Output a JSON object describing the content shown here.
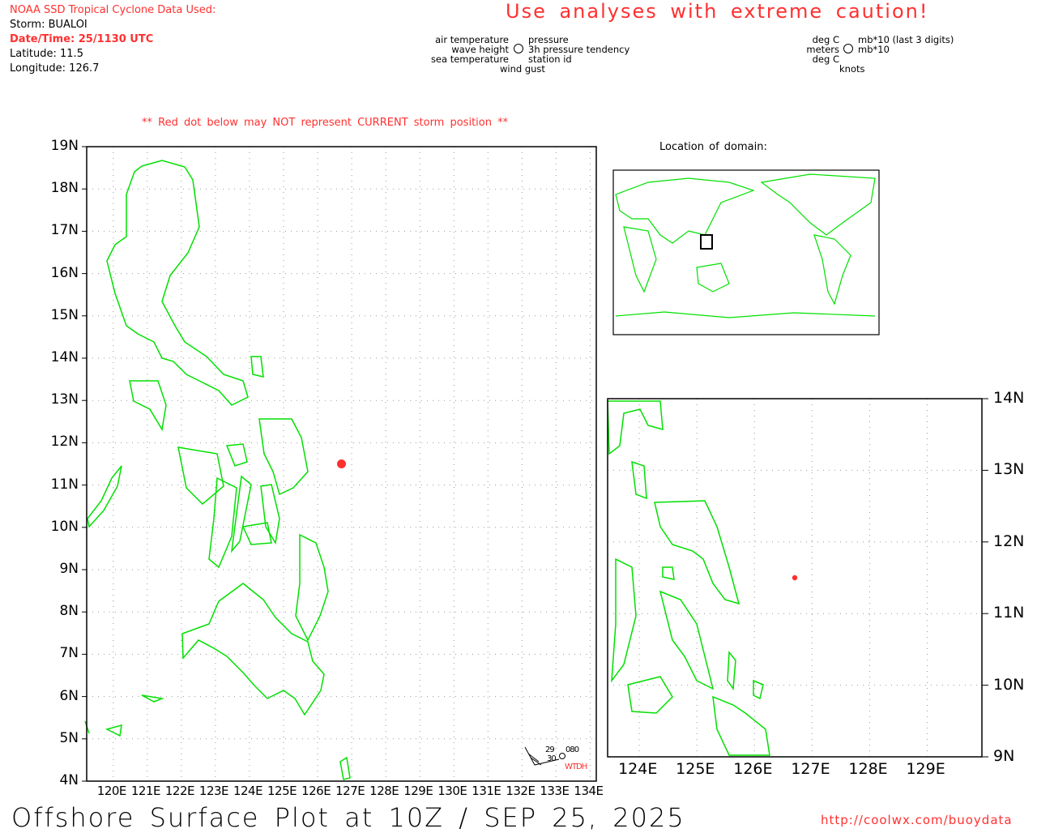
{
  "header": {
    "source": "NOAA SSD Tropical Cyclone Data Used:",
    "storm": "Storm: BUALOI",
    "datetime": "Date/Time: 25/1130 UTC",
    "latitude": "Latitude: 11.5",
    "longitude": "Longitude: 126.7",
    "caution": "Use analyses with extreme caution!"
  },
  "legend": {
    "left": {
      "tl": "air temperature",
      "tr": "pressure",
      "ml": "wave height",
      "mr": "3h pressure tendency",
      "bl": "sea temperature",
      "br": "station id",
      "bottom": "wind gust"
    },
    "right": {
      "tl": "deg C",
      "tr": "mb*10 (last 3 digits)",
      "ml": "meters",
      "mr": "mb*10",
      "bl": "deg C",
      "bottom": "knots"
    }
  },
  "warning": "** Red dot below may NOT represent CURRENT storm position **",
  "location_title": "Location of domain:",
  "storm": {
    "lat": 11.5,
    "lon": 126.7
  },
  "main_map": {
    "lon_range": [
      119.22,
      134.18
    ],
    "lat_range": [
      4,
      19
    ],
    "lon_ticks": [
      {
        "v": 120,
        "t": "120E"
      },
      {
        "v": 121,
        "t": "121E"
      },
      {
        "v": 122,
        "t": "122E"
      },
      {
        "v": 123,
        "t": "123E"
      },
      {
        "v": 124,
        "t": "124E"
      },
      {
        "v": 125,
        "t": "125E"
      },
      {
        "v": 126,
        "t": "126E"
      },
      {
        "v": 127,
        "t": "127E"
      },
      {
        "v": 128,
        "t": "128E"
      },
      {
        "v": 129,
        "t": "129E"
      },
      {
        "v": 130,
        "t": "130E"
      },
      {
        "v": 131,
        "t": "131E"
      },
      {
        "v": 132,
        "t": "132E"
      },
      {
        "v": 133,
        "t": "133E"
      },
      {
        "v": 134,
        "t": "134E"
      }
    ],
    "lat_ticks": [
      {
        "v": 4,
        "t": "4N"
      },
      {
        "v": 5,
        "t": "5N"
      },
      {
        "v": 6,
        "t": "6N"
      },
      {
        "v": 7,
        "t": "7N"
      },
      {
        "v": 8,
        "t": "8N"
      },
      {
        "v": 9,
        "t": "9N"
      },
      {
        "v": 10,
        "t": "10N"
      },
      {
        "v": 11,
        "t": "11N"
      },
      {
        "v": 12,
        "t": "12N"
      },
      {
        "v": 13,
        "t": "13N"
      },
      {
        "v": 14,
        "t": "14N"
      },
      {
        "v": 15,
        "t": "15N"
      },
      {
        "v": 16,
        "t": "16N"
      },
      {
        "v": 17,
        "t": "17N"
      },
      {
        "v": 18,
        "t": "18N"
      },
      {
        "v": 19,
        "t": "19N"
      }
    ]
  },
  "zoom_map": {
    "lon_range": [
      123.45,
      129.95
    ],
    "lat_range": [
      9,
      14
    ],
    "lon_ticks": [
      {
        "v": 124,
        "t": "124E"
      },
      {
        "v": 125,
        "t": "125E"
      },
      {
        "v": 126,
        "t": "126E"
      },
      {
        "v": 127,
        "t": "127E"
      },
      {
        "v": 128,
        "t": "128E"
      },
      {
        "v": 129,
        "t": "129E"
      }
    ],
    "lat_ticks": [
      {
        "v": 9,
        "t": "9N"
      },
      {
        "v": 10,
        "t": "10N"
      },
      {
        "v": 11,
        "t": "11N"
      },
      {
        "v": 12,
        "t": "12N"
      },
      {
        "v": 13,
        "t": "13N"
      },
      {
        "v": 14,
        "t": "14N"
      }
    ]
  },
  "station": {
    "air_temp": "29",
    "pressure": "080",
    "sea_temp": "30",
    "id": "WTDH"
  },
  "footer": {
    "title": "Offshore Surface Plot at 10Z / SEP 25, 2025",
    "url": "http://coolwx.com/buoydata"
  },
  "colors": {
    "coast": "#00e000",
    "storm": "#ff3030",
    "text_red": "#ff3030"
  }
}
